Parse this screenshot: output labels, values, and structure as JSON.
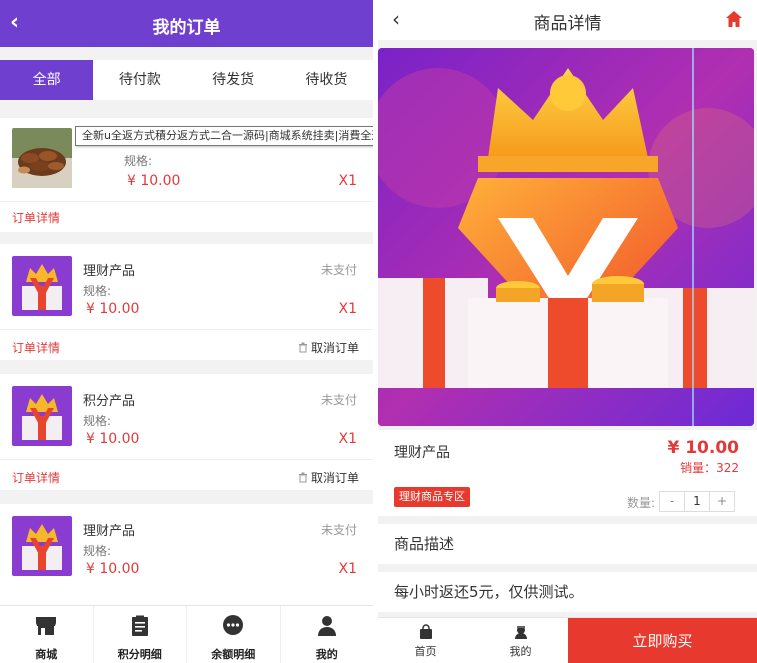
{
  "left": {
    "header": {
      "title": "我的订单"
    },
    "tabs": [
      "全部",
      "待付款",
      "待发货",
      "待收货"
    ],
    "tooltip": "全新u全返方式積分返方式二合一源码|商城系统挂卖|消費全返无错版经营版",
    "orders": [
      {
        "name": "",
        "status": "",
        "spec": "规格:",
        "price": "¥ 10.00",
        "qty": "X1",
        "detail": "订单详情",
        "cancel": ""
      },
      {
        "name": "理财产品",
        "status": "未支付",
        "spec": "规格:",
        "price": "¥ 10.00",
        "qty": "X1",
        "detail": "订单详情",
        "cancel": "取消订单"
      },
      {
        "name": "积分产品",
        "status": "未支付",
        "spec": "规格:",
        "price": "¥ 10.00",
        "qty": "X1",
        "detail": "订单详情",
        "cancel": "取消订单"
      },
      {
        "name": "理财产品",
        "status": "未支付",
        "spec": "规格:",
        "price": "¥ 10.00",
        "qty": "X1",
        "detail": "",
        "cancel": ""
      }
    ],
    "nav": [
      "商城",
      "积分明细",
      "余额明细",
      "我的"
    ]
  },
  "right": {
    "header": {
      "title": "商品详情"
    },
    "product": {
      "name": "理财产品",
      "price": "¥ 10.00",
      "sales": "销量：322",
      "zone": "理财商品专区",
      "qty_label": "数量:",
      "qty_minus": "-",
      "qty_value": "1",
      "qty_plus": "+"
    },
    "desc_title": "商品描述",
    "desc_body": "每小时返还5元，仅供测试。",
    "nav": {
      "home": "首页",
      "mine": "我的",
      "buy": "立即购买"
    }
  },
  "colors": {
    "accent": "#6f3fd0",
    "red": "#e8392f",
    "price_red": "#e23a3a"
  }
}
